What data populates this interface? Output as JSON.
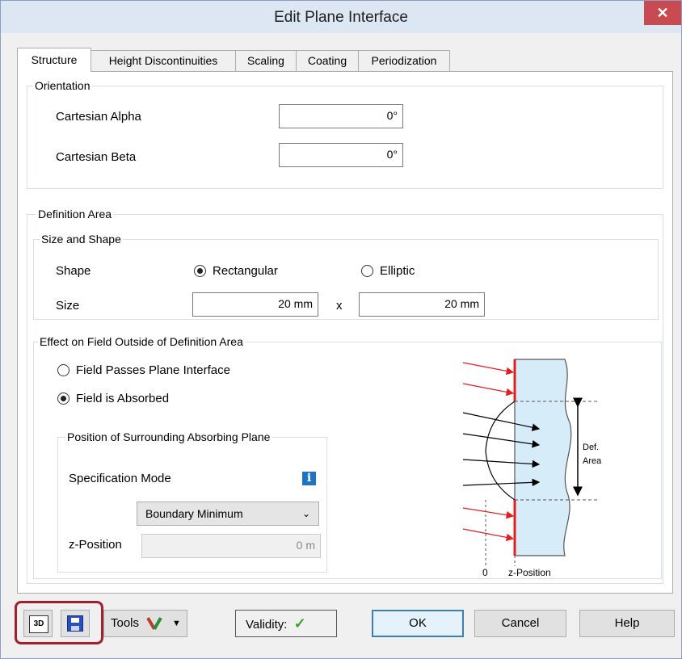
{
  "window": {
    "title": "Edit Plane Interface",
    "close_glyph": "✕"
  },
  "tabs": [
    {
      "label": "Structure",
      "active": true
    },
    {
      "label": "Height Discontinuities",
      "active": false
    },
    {
      "label": "Scaling",
      "active": false
    },
    {
      "label": "Coating",
      "active": false
    },
    {
      "label": "Periodization",
      "active": false
    }
  ],
  "orientation": {
    "legend": "Orientation",
    "alpha_label": "Cartesian Alpha",
    "alpha_value": "0°",
    "beta_label": "Cartesian Beta",
    "beta_value": "0°"
  },
  "definition_area": {
    "legend": "Definition Area",
    "size_shape": {
      "legend": "Size and Shape",
      "shape_label": "Shape",
      "shape_rect": "Rectangular",
      "shape_elliptic": "Elliptic",
      "selected_shape": "Rectangular",
      "size_label": "Size",
      "size_x": "20 mm",
      "size_times": "x",
      "size_y": "20 mm"
    },
    "effect": {
      "legend": "Effect on Field Outside of Definition Area",
      "option_passes": "Field Passes Plane Interface",
      "option_absorbed": "Field is Absorbed",
      "selected": "Field is Absorbed",
      "surrounding": {
        "legend": "Position of Surrounding Absorbing Plane",
        "spec_mode_label": "Specification Mode",
        "spec_mode_value": "Boundary Minimum",
        "zpos_label": "z-Position",
        "zpos_value": "0 m"
      },
      "diagram": {
        "def_label_1": "Def.",
        "def_label_2": "Area",
        "zero_label": "0",
        "zpos_label": "z-Position"
      }
    }
  },
  "footer": {
    "tools_label": "Tools",
    "validity_label": "Validity:",
    "validity_mark": "✓",
    "ok_label": "OK",
    "cancel_label": "Cancel",
    "help_label": "Help",
    "icon_3d_text": "3D"
  },
  "colors": {
    "highlight_border": "#a31f2b",
    "validity_check": "#3aa02c",
    "info_icon": "#1f72c4",
    "diagram_fill": "#d7ecf9",
    "diagram_red": "#e02020"
  }
}
